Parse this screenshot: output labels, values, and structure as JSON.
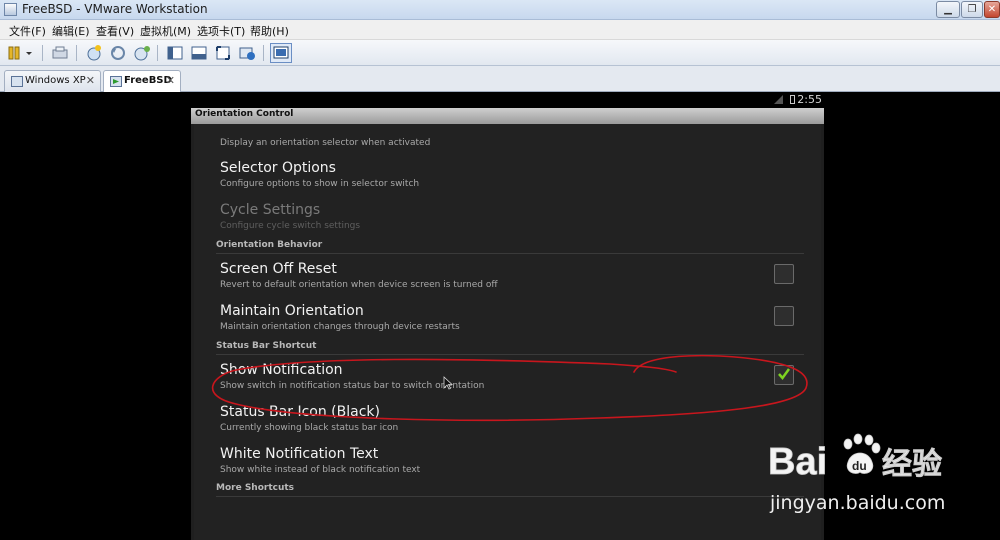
{
  "window": {
    "title": "FreeBSD - VMware Workstation",
    "min_glyph": "▁",
    "max_glyph": "❐",
    "close_glyph": "✕"
  },
  "menu": [
    "文件(F)",
    "编辑(E)",
    "查看(V)",
    "虚拟机(M)",
    "选项卡(T)",
    "帮助(H)"
  ],
  "tabs": [
    {
      "label": "Windows XP",
      "close": "✕"
    },
    {
      "label": "FreeBSD",
      "close": "✕"
    }
  ],
  "android_status": {
    "time": "2:55"
  },
  "app": {
    "title": "Orientation Control",
    "top_partial_subtitle": "Display an orientation selector when activated",
    "items": [
      {
        "title": "Selector Options",
        "subtitle": "Configure options to show in selector switch",
        "enabled": true
      },
      {
        "title": "Cycle Settings",
        "subtitle": "Configure cycle switch settings",
        "enabled": false
      }
    ],
    "category_behavior": "Orientation Behavior",
    "behavior_items": [
      {
        "title": "Screen Off Reset",
        "subtitle": "Revert to default orientation when device screen is turned off",
        "checked": false
      },
      {
        "title": "Maintain Orientation",
        "subtitle": "Maintain orientation changes through device restarts",
        "checked": false
      }
    ],
    "category_statusbar": "Status Bar Shortcut",
    "statusbar_items": [
      {
        "title": "Show Notification",
        "subtitle": "Show switch in notification status bar to switch orientation",
        "checked": true
      },
      {
        "title": "Status Bar Icon (Black)",
        "subtitle": "Currently showing black status bar icon"
      },
      {
        "title": "White Notification Text",
        "subtitle": "Show white instead of black notification text"
      }
    ],
    "category_more": "More Shortcuts"
  },
  "watermark": {
    "brand": "Baidu经验",
    "url": "jingyan.baidu.com"
  },
  "colors": {
    "annotation": "#c8161d",
    "check_green": "#7ed321"
  }
}
